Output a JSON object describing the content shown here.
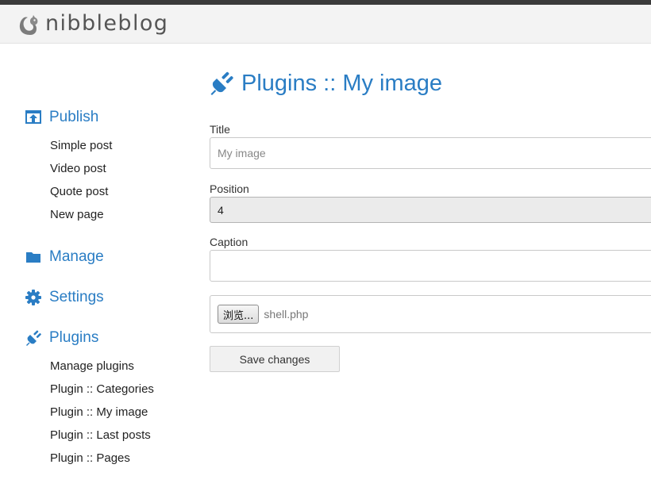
{
  "header": {
    "brand": "nibbleblog",
    "logo_icon": "squirrel-logo-icon"
  },
  "sidebar": {
    "publish": {
      "label": "Publish",
      "icon": "publish-icon",
      "items": [
        "Simple post",
        "Video post",
        "Quote post",
        "New page"
      ]
    },
    "manage": {
      "label": "Manage",
      "icon": "folder-icon"
    },
    "settings": {
      "label": "Settings",
      "icon": "gear-icon"
    },
    "plugins": {
      "label": "Plugins",
      "icon": "plug-icon",
      "items": [
        "Manage plugins",
        "Plugin :: Categories",
        "Plugin :: My image",
        "Plugin :: Last posts",
        "Plugin :: Pages"
      ]
    }
  },
  "main": {
    "title": "Plugins :: My image",
    "title_icon": "plug-icon",
    "form": {
      "title_label": "Title",
      "title_placeholder": "My image",
      "title_value": "",
      "position_label": "Position",
      "position_value": "4",
      "caption_label": "Caption",
      "caption_value": "",
      "browse_label": "浏览...",
      "file_name": "shell.php",
      "save_label": "Save changes"
    }
  },
  "colors": {
    "accent": "#2a7dc4",
    "header_bg": "#f3f3f3",
    "top_bar": "#3a3a3a"
  }
}
